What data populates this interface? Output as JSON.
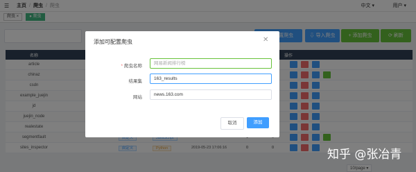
{
  "topbar": {
    "menu_icon": "hamburger-icon",
    "breadcrumbs": [
      "主页",
      "爬虫",
      "爬虫"
    ],
    "language": "中文",
    "user": "用户"
  },
  "tags": [
    {
      "label": "爬虫"
    },
    {
      "label": "爬虫"
    }
  ],
  "toolbar": {
    "search_placeholder": "",
    "buttons": [
      {
        "label": "可配置爬虫"
      },
      {
        "label": "导入爬虫"
      },
      {
        "label": "添加爬虫"
      },
      {
        "label": "刷新"
      }
    ]
  },
  "table": {
    "headers": [
      "名称",
      "操作"
    ],
    "rows": [
      {
        "name": "article",
        "type": "",
        "language": "",
        "time": "",
        "n1": "",
        "n2": "",
        "extra": false
      },
      {
        "name": "chinaz",
        "type": "",
        "language": "",
        "time": "",
        "n1": "",
        "n2": "",
        "extra": true
      },
      {
        "name": "csdn",
        "type": "",
        "language": "",
        "time": "",
        "n1": "",
        "n2": "",
        "extra": false
      },
      {
        "name": "example_juejin",
        "type": "",
        "language": "",
        "time": "",
        "n1": "",
        "n2": "",
        "extra": false
      },
      {
        "name": "jd",
        "type": "",
        "language": "",
        "time": "",
        "n1": "",
        "n2": "",
        "extra": false
      },
      {
        "name": "juejin_node",
        "type": "",
        "language": "",
        "time": "",
        "n1": "",
        "n2": "",
        "extra": false
      },
      {
        "name": "realestate",
        "type": "",
        "language": "",
        "time": "",
        "n1": "",
        "n2": "",
        "extra": false
      },
      {
        "name": "segmentfault",
        "type": "自定义",
        "language": "JavaScript",
        "time": "",
        "n1": "1",
        "n2": "0",
        "extra": true
      },
      {
        "name": "sites_inspector",
        "type": "自定义",
        "language": "Python",
        "time": "2019-05-23 17:06:16",
        "n1": "0",
        "n2": "0",
        "extra": false
      }
    ],
    "pager": "10/page"
  },
  "dialog": {
    "title": "添加可配置爬虫",
    "close_icon": "close-icon",
    "fields": {
      "name": {
        "label": "爬虫名称",
        "value": "",
        "placeholder": "网易新闻排行榜"
      },
      "collection": {
        "label": "结果集",
        "value": "163_results"
      },
      "site": {
        "label": "网站",
        "value": "news.163.com"
      }
    },
    "cancel_label": "取消",
    "add_label": "添加"
  },
  "watermark": "知乎 @张冶青",
  "colors": {
    "primary": "#409eff",
    "success": "#67c23a",
    "danger": "#f56c6c",
    "header_bg": "#304156"
  }
}
